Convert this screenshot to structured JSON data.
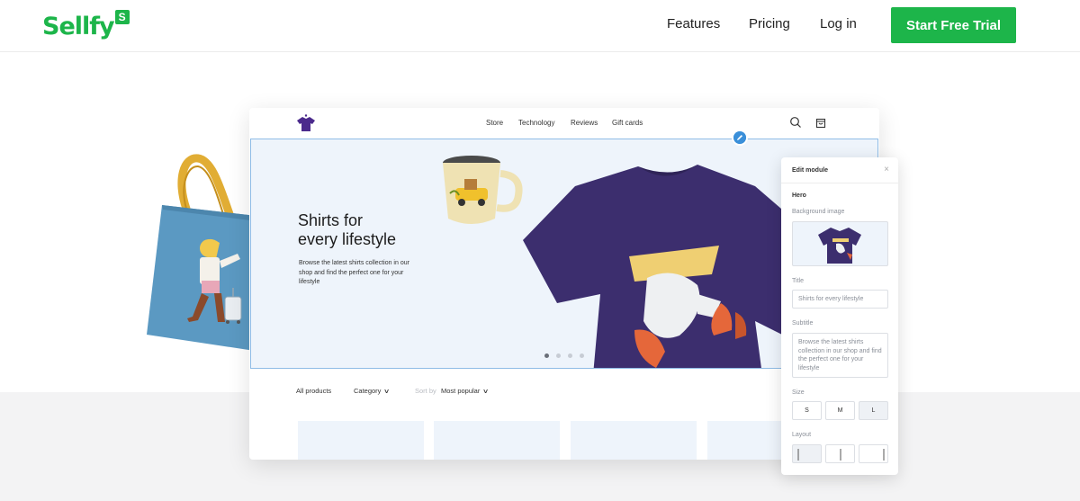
{
  "brand": {
    "name": "Sellfy",
    "badge": "S",
    "color": "#1db54a"
  },
  "nav": {
    "features": "Features",
    "pricing": "Pricing",
    "login": "Log in",
    "cta": "Start Free Trial"
  },
  "store": {
    "links": [
      "Store",
      "Technology",
      "Reviews",
      "Gift cards"
    ],
    "icons": [
      "search-icon",
      "cart-icon"
    ],
    "hero": {
      "title": "Shirts for\nevery lifestyle",
      "subtitle": "Browse the latest shirts collection in our shop and find the perfect one for your lifestyle"
    },
    "filters": {
      "all_products": "All products",
      "category": "Category",
      "sort_by": "Sort by",
      "sort_value": "Most popular"
    }
  },
  "panel": {
    "header": "Edit module",
    "close": "×",
    "section": "Hero",
    "background_label": "Background image",
    "title_label": "Title",
    "title_value": "Shirts for every lifestyle",
    "subtitle_label": "Subtitle",
    "subtitle_value": "Browse the latest shirts collection in our shop and find the perfect one for your lifestyle",
    "size_label": "Size",
    "sizes": [
      "S",
      "M",
      "L"
    ],
    "selected_size": "L",
    "layout_label": "Layout"
  }
}
